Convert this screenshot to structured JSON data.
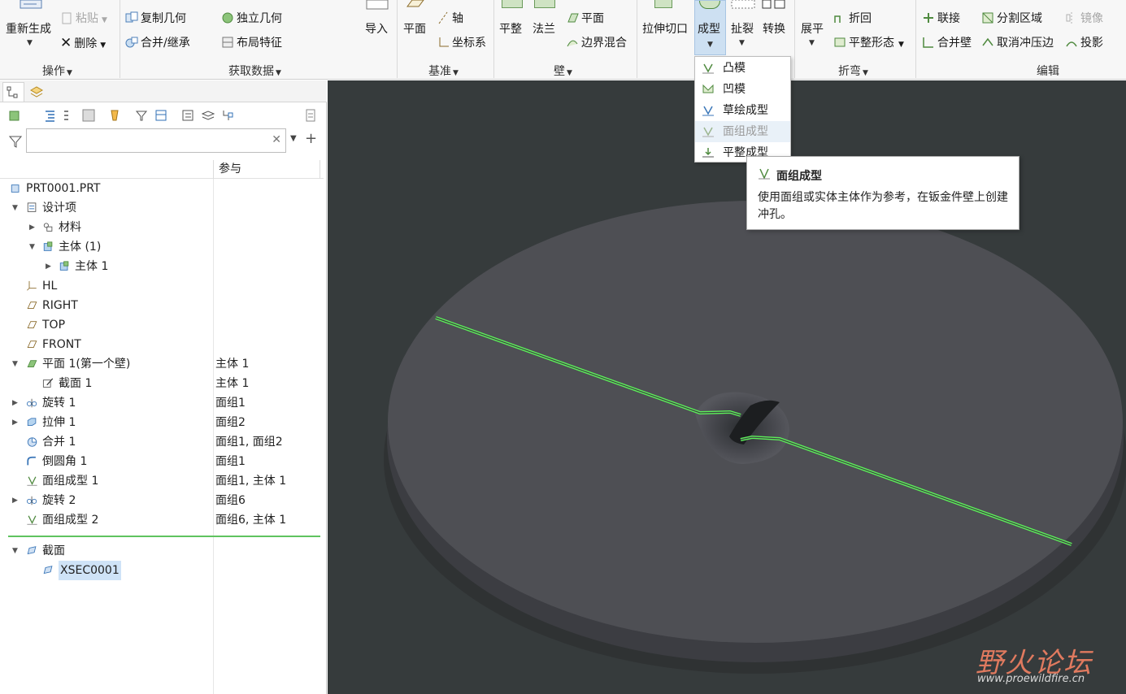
{
  "ribbon": {
    "operations": {
      "regenerate": "重新生成",
      "paste": "粘贴",
      "delete": "删除",
      "group_label": "操作"
    },
    "get_data": {
      "copy_geometry": "复制几何",
      "merge_inherit": "合并/继承",
      "independent_geometry": "独立几何",
      "layout_feature": "布局特征",
      "group_label": "获取数据"
    },
    "import": "导入",
    "datum": {
      "plane": "平面",
      "axis": "轴",
      "coordinate_system": "坐标系",
      "group_label": "基准"
    },
    "walls": {
      "flat": "平整",
      "flange": "法兰",
      "plane": "平面",
      "boundary_blend": "边界混合",
      "group_label": "壁"
    },
    "extrude_cut": "拉伸切口",
    "form": "成型",
    "rip": "扯裂",
    "convert": "转换",
    "bends": {
      "unbend": "展平",
      "bend_back": "折回",
      "flat_state": "平整形态",
      "group_label": "折弯"
    },
    "editing": {
      "join": "联接",
      "split_area": "分割区域",
      "mirror": "镜像",
      "merge_walls": "合并壁",
      "unstamp_edges": "取消冲压边",
      "project": "投影",
      "group_label": "编辑"
    }
  },
  "form_menu": {
    "items": [
      {
        "label": "凸模",
        "enabled": true
      },
      {
        "label": "凹模",
        "enabled": true
      },
      {
        "label": "草绘成型",
        "enabled": true
      },
      {
        "label": "面组成型",
        "enabled": false
      },
      {
        "label": "平整成型",
        "enabled": true
      }
    ]
  },
  "tooltip": {
    "title": "面组成型",
    "body": "使用面组或实体主体作为参考，在钣金件壁上创建冲孔。"
  },
  "model_tree": {
    "column_header": "参与",
    "filter_placeholder": "",
    "rows": [
      {
        "name": "PRT0001.PRT",
        "ref": ""
      },
      {
        "name": "设计项",
        "ref": ""
      },
      {
        "name": "材料",
        "ref": ""
      },
      {
        "name": "主体 (1)",
        "ref": ""
      },
      {
        "name": "主体 1",
        "ref": ""
      },
      {
        "name": "HL",
        "ref": ""
      },
      {
        "name": "RIGHT",
        "ref": ""
      },
      {
        "name": "TOP",
        "ref": ""
      },
      {
        "name": "FRONT",
        "ref": ""
      },
      {
        "name": "平面 1(第一个壁)",
        "ref": "主体 1"
      },
      {
        "name": "截面 1",
        "ref": "主体 1"
      },
      {
        "name": "旋转 1",
        "ref": "面组1"
      },
      {
        "name": "拉伸 1",
        "ref": "面组2"
      },
      {
        "name": "合并 1",
        "ref": "面组1, 面组2"
      },
      {
        "name": "倒圆角 1",
        "ref": "面组1"
      },
      {
        "name": "面组成型 1",
        "ref": "面组1, 主体 1"
      },
      {
        "name": "旋转 2",
        "ref": "面组6"
      },
      {
        "name": "面组成型 2",
        "ref": "面组6, 主体 1"
      },
      {
        "name": "截面",
        "ref": ""
      },
      {
        "name": "XSEC0001",
        "ref": ""
      }
    ]
  },
  "watermark": {
    "text": "野火论坛",
    "url": "www.proewildfire.cn"
  },
  "colors": {
    "viewport_bg": "#363b3c",
    "highlight_edge": "#5df05a",
    "accent": "#2f7fd3"
  }
}
